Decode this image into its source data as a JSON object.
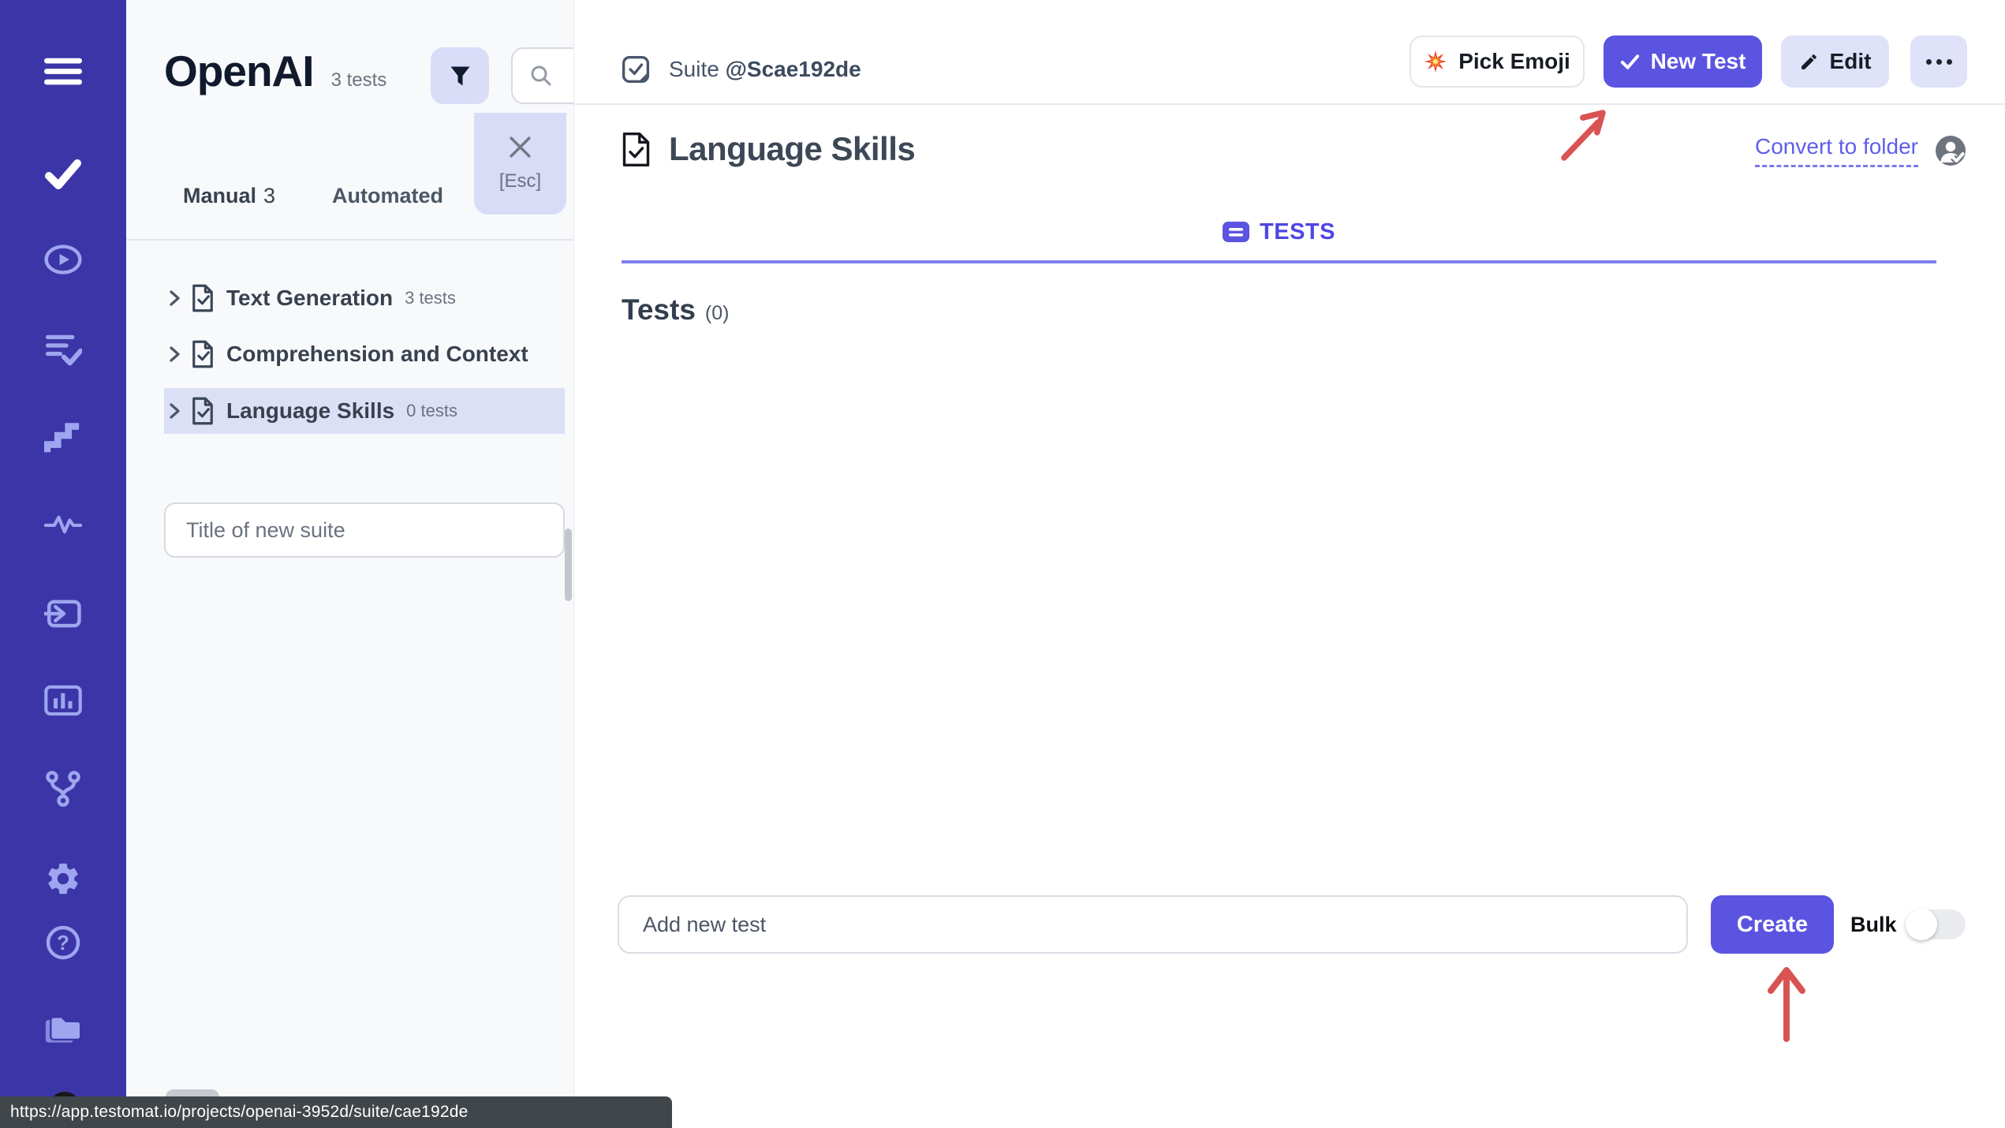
{
  "colors": {
    "accent": "#5b54e1",
    "sidebar_bg": "#3c35a7",
    "selected_row_bg": "#dce0f7",
    "link": "#5f5fe7",
    "tab_active": "#4e46e4",
    "annotation_arrow": "#d95353"
  },
  "sidebar": {
    "icons": [
      "menu",
      "tests",
      "runs",
      "results",
      "steps",
      "pulse",
      "import",
      "analytics",
      "branch",
      "settings",
      "help",
      "files"
    ]
  },
  "project_panel": {
    "title": "OpenAI",
    "tests_count": "3 tests",
    "filter_popover": {
      "esc_hint": "[Esc]"
    },
    "tabs": {
      "manual": "Manual",
      "manual_count": "3",
      "automated": "Automated"
    },
    "tree": [
      {
        "label": "Text Generation",
        "count": "3 tests"
      },
      {
        "label": "Comprehension and Context",
        "count": ""
      },
      {
        "label": "Language Skills",
        "count": "0 tests"
      }
    ],
    "new_suite_input": {
      "placeholder": "Title of new suite"
    }
  },
  "main": {
    "suite_badge": {
      "label": "Suite",
      "id": "@Scae192de"
    },
    "toolbar": {
      "pick_emoji": "Pick Emoji",
      "pick_emoji_icon": "💥",
      "new_test": "New Test",
      "edit": "Edit"
    },
    "heading": "Language Skills",
    "convert_link": "Convert to folder",
    "tests_tab": "TESTS",
    "tests_section": {
      "title": "Tests",
      "count": "(0)"
    },
    "add_test": {
      "placeholder": "Add new test",
      "create": "Create",
      "bulk": "Bulk"
    }
  },
  "statusbar": {
    "url": "https://app.testomat.io/projects/openai-3952d/suite/cae192de"
  }
}
